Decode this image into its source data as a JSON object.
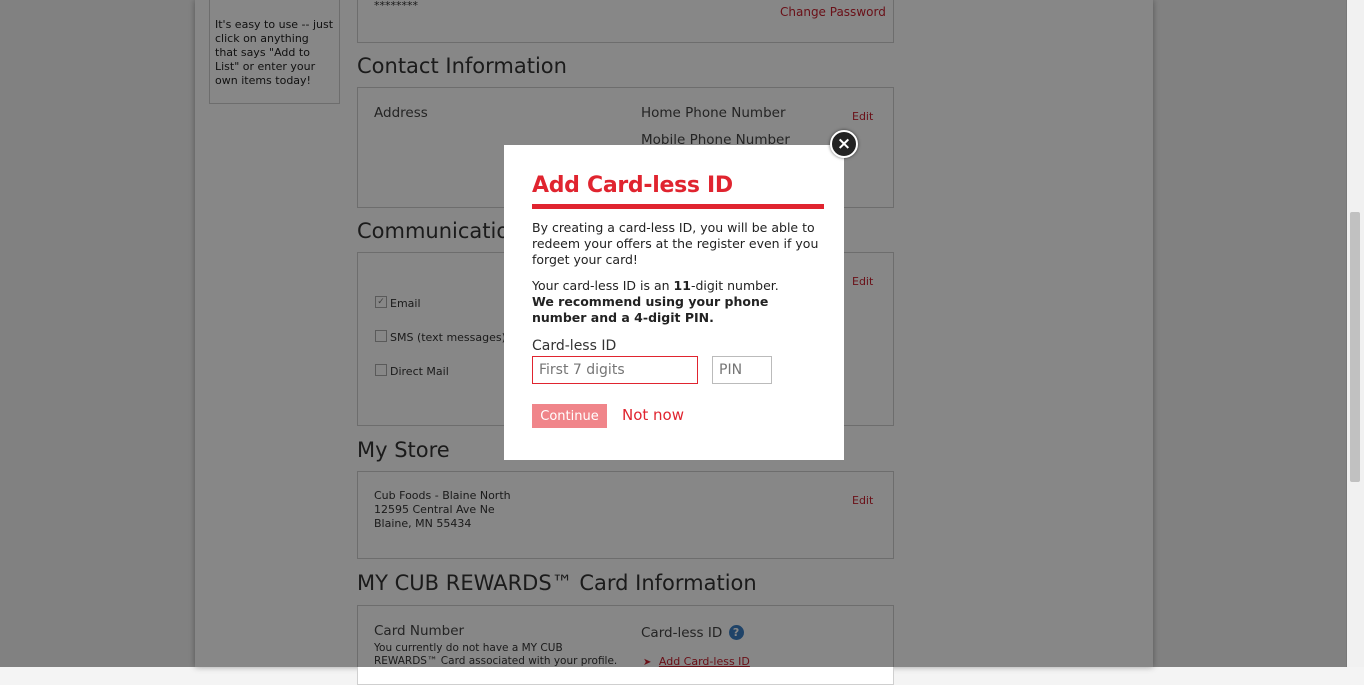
{
  "sidebar_tip": {
    "text": "It's easy to use -- just click on anything that says \"Add to List\" or enter your own items today!"
  },
  "password": {
    "masked_value": "********",
    "change_link": "Change Password"
  },
  "contact": {
    "heading": "Contact Information",
    "address_label": "Address",
    "home_phone_label": "Home Phone Number",
    "mobile_phone_label": "Mobile Phone Number",
    "edit": "Edit"
  },
  "communication": {
    "heading": "Communication Preferences",
    "edit": "Edit",
    "options": [
      {
        "label": "Email",
        "checked": true
      },
      {
        "label": "SMS (text messages)",
        "checked": false
      },
      {
        "label": "Direct Mail",
        "checked": false
      }
    ]
  },
  "store": {
    "heading": "My Store",
    "name": "Cub Foods - Blaine North",
    "street": "12595 Central Ave Ne",
    "city": "Blaine, MN  55434",
    "edit": "Edit"
  },
  "rewards": {
    "heading": "MY CUB REWARDS™ Card Information",
    "card_number_label": "Card Number",
    "card_note": "You currently do not have a MY CUB REWARDS™ Card associated with your profile.",
    "cardless_label": "Card-less ID",
    "add_link": "Add Card-less ID",
    "help_icon": "?"
  },
  "modal": {
    "title": "Add Card-less ID",
    "intro": "By creating a card-less ID, you will be able to redeem your offers at the register even if you forget your card!",
    "info_pre": "Your card-less ID is an ",
    "info_bold": "11",
    "info_post": "-digit number.",
    "recommend": "We recommend using your phone number and a 4-digit PIN.",
    "field_label": "Card-less ID",
    "first7_placeholder": "First 7 digits",
    "pin_placeholder": "PIN",
    "continue_label": "Continue",
    "not_now_label": "Not now",
    "close_glyph": "×"
  },
  "colors": {
    "accent": "#e0242f",
    "button_disabled": "#f0858a",
    "overlay": "rgba(0,0,0,0.47)"
  }
}
